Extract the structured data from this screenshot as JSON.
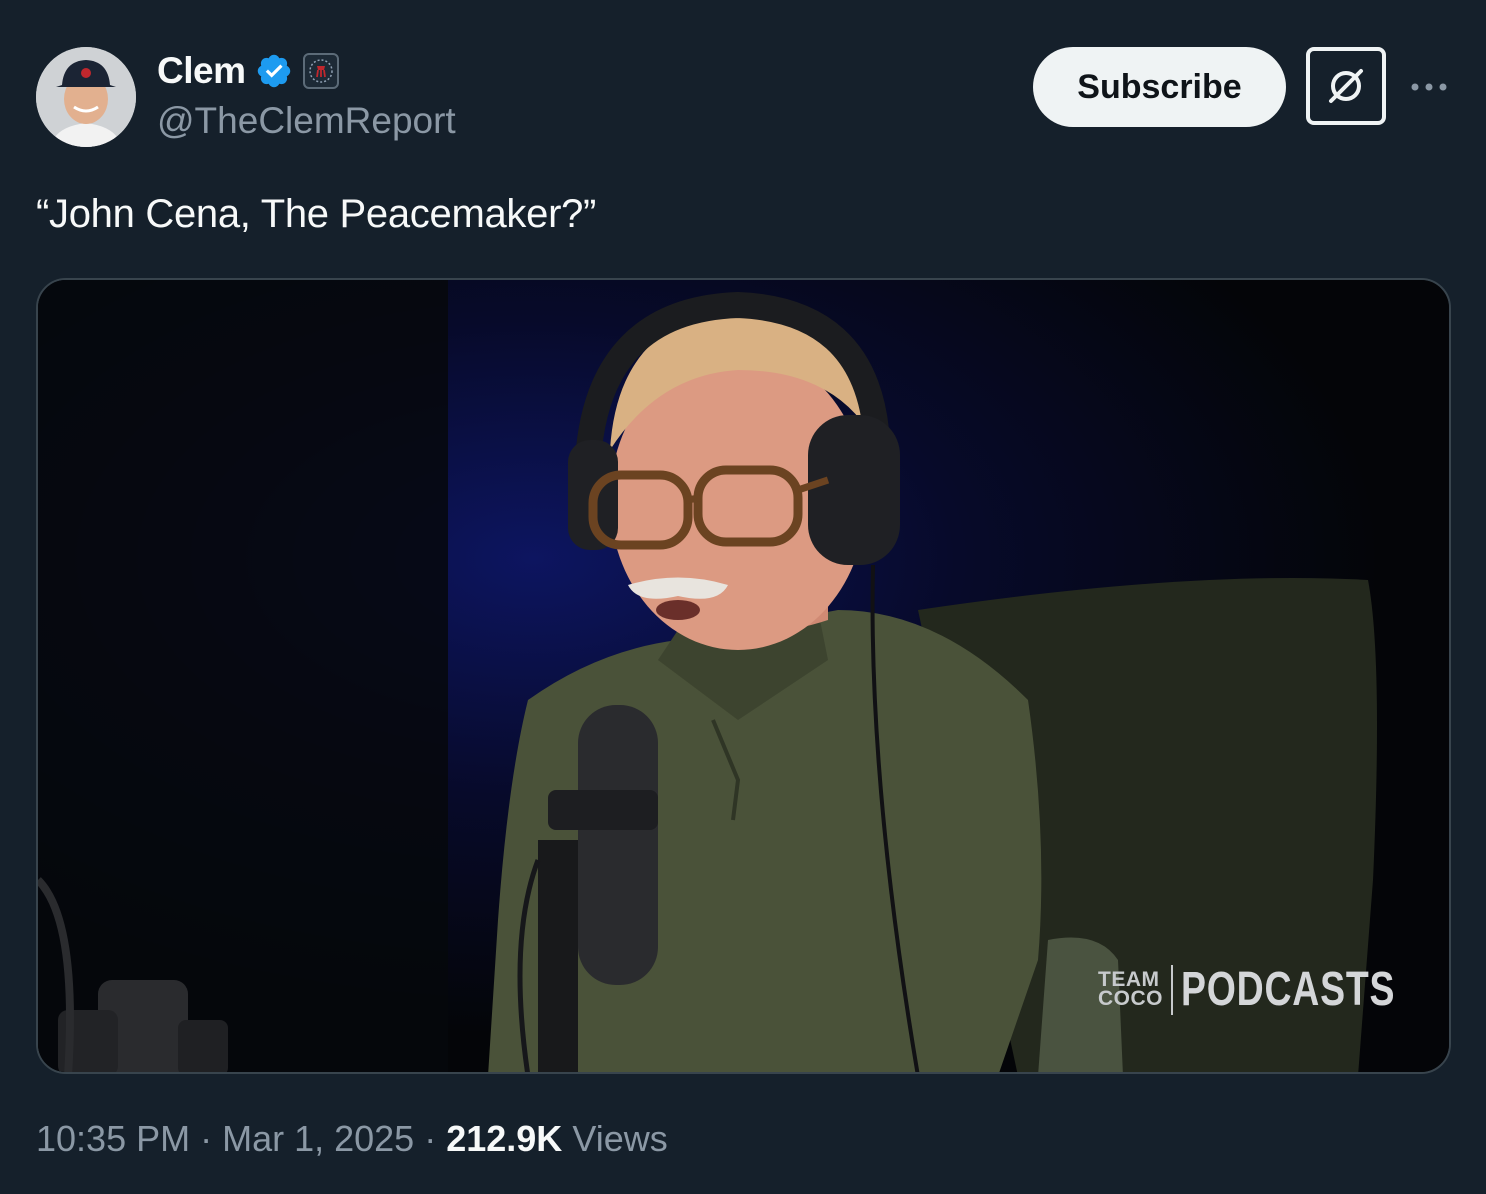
{
  "author": {
    "display_name": "Clem",
    "handle": "@TheClemReport",
    "verified_icon": "verified-badge-icon",
    "affiliation_icon": "barstool-logo-icon"
  },
  "actions": {
    "subscribe_label": "Subscribe",
    "grok_icon": "grok-icon",
    "more_icon": "more-dots-icon"
  },
  "tweet": {
    "text": "“John Cena, The Peacemaker?”"
  },
  "media": {
    "watermark_team": "TEAM",
    "watermark_coco": "COCO",
    "watermark_podcasts": "PODCASTS"
  },
  "meta": {
    "time": "10:35 PM",
    "sep1": "·",
    "date": "Mar 1, 2025",
    "sep2": "·",
    "views_count": "212.9K",
    "views_label": "Views"
  },
  "colors": {
    "background": "#15202b",
    "verified": "#1d9bf0",
    "muted_text": "#8b98a5"
  }
}
